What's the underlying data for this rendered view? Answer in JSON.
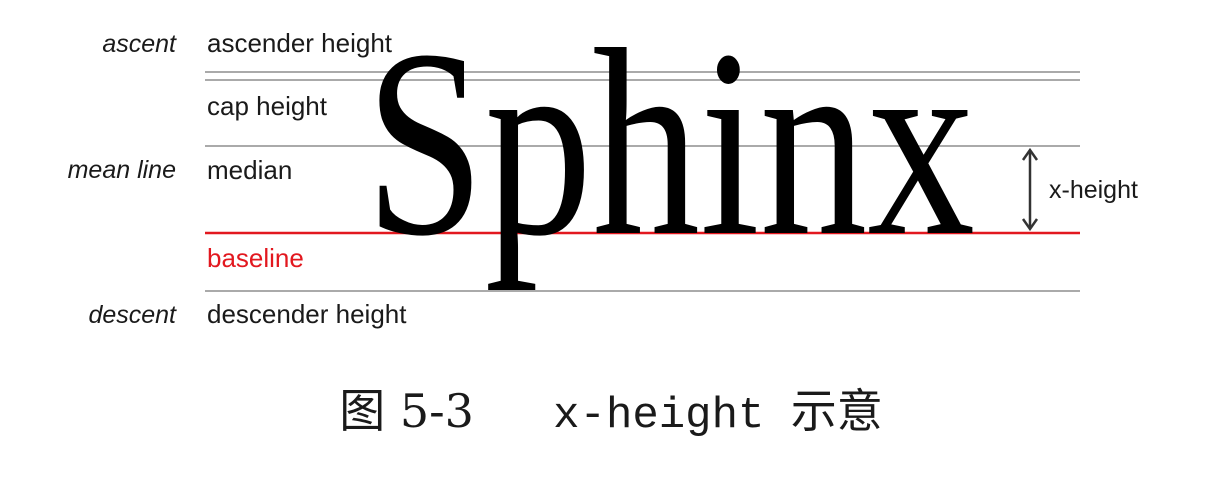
{
  "side_labels": {
    "ascent": "ascent",
    "mean_line": "mean line",
    "descent": "descent"
  },
  "line_labels": {
    "ascender_height": "ascender height",
    "cap_height": "cap height",
    "median": "median",
    "baseline": "baseline",
    "descender_height": "descender height"
  },
  "sample_word": "Sphinx",
  "x_height_label": "x-height",
  "caption": {
    "figure_number": "图 5-3",
    "term": "x-height",
    "suffix": "示意"
  },
  "colors": {
    "baseline": "#e2181f",
    "guide": "#aaaaaa",
    "text": "#1a1a1a"
  }
}
